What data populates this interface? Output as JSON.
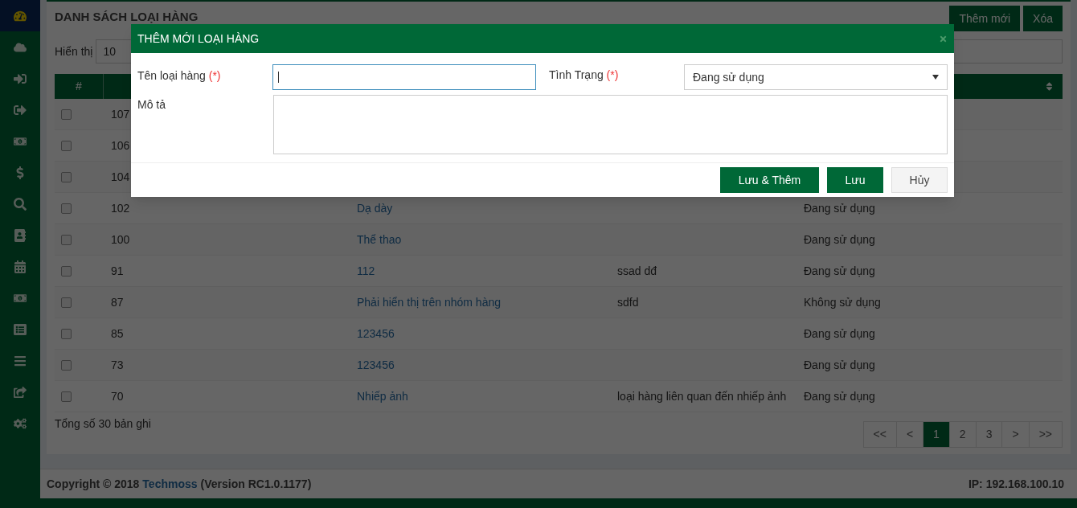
{
  "sidebar": {
    "items": [
      {
        "selected": true
      },
      {
        "selected": false
      },
      {
        "selected": false
      },
      {
        "selected": false
      },
      {
        "selected": false
      },
      {
        "selected": false
      },
      {
        "selected": false
      },
      {
        "selected": false
      },
      {
        "selected": false
      },
      {
        "selected": false
      },
      {
        "selected": false
      },
      {
        "selected": false
      },
      {
        "selected": false
      },
      {
        "selected": false
      }
    ]
  },
  "page": {
    "title": "DANH SÁCH LOẠI HÀNG",
    "buttons": [
      "Thêm mới",
      "Xóa"
    ],
    "show_label": "Hiển thị",
    "page_size": "10"
  },
  "table": {
    "columns": [
      "#"
    ],
    "rows": [
      {
        "id": "107",
        "checked": false
      },
      {
        "id": "106",
        "checked": false
      },
      {
        "id": "104",
        "checked": false
      },
      {
        "id": "102",
        "name": "Dạ dày",
        "description": "",
        "status": "Đang sử dụng",
        "checked": false
      },
      {
        "id": "100",
        "name": "Thể thao",
        "description": "",
        "status": "Đang sử dụng",
        "checked": false
      },
      {
        "id": "91",
        "name": "112",
        "description": "ssad dđ",
        "status": "Đang sử dụng",
        "checked": false
      },
      {
        "id": "87",
        "name": "Phải hiển thị trên nhóm hàng",
        "description": "sdfd",
        "status": "Không sử dụng",
        "checked": false
      },
      {
        "id": "85",
        "name": "123456",
        "description": "",
        "status": "Đang sử dụng",
        "checked": false
      },
      {
        "id": "73",
        "name": "123456",
        "description": "",
        "status": "Đang sử dụng",
        "checked": false
      },
      {
        "id": "70",
        "name": "Nhiếp ảnh",
        "description": "loại hàng liên quan đến nhiếp ảnh",
        "status": "Đang sử dụng",
        "checked": false
      }
    ]
  },
  "total": "Tổng số 30 bản ghi",
  "pagination": [
    {
      "label": "<<",
      "selected": false
    },
    {
      "label": "<",
      "selected": false
    },
    {
      "label": "1",
      "selected": true
    },
    {
      "label": "2",
      "selected": false
    },
    {
      "label": "3",
      "selected": false
    },
    {
      "label": ">",
      "selected": false
    },
    {
      "label": ">>",
      "selected": false
    }
  ],
  "footer": {
    "copyright": "Copyright © 2018",
    "brand": "Techmoss",
    "version": "(Version RC1.0.1177)",
    "ip": "IP: 192.168.100.10"
  },
  "dialog": {
    "title": "THÊM MỚI LOẠI HÀNG",
    "name_label": "Tên loại hàng",
    "status_label": "Tình Trạng",
    "required_mark": "(*)",
    "status_value": "Đang sử dụng",
    "description_label": "Mô tả",
    "buttons": [
      {
        "label": "Lưu & Thêm",
        "kind": "primary"
      },
      {
        "label": "Lưu",
        "kind": "primary"
      },
      {
        "label": "Hủy",
        "kind": "default"
      }
    ]
  }
}
